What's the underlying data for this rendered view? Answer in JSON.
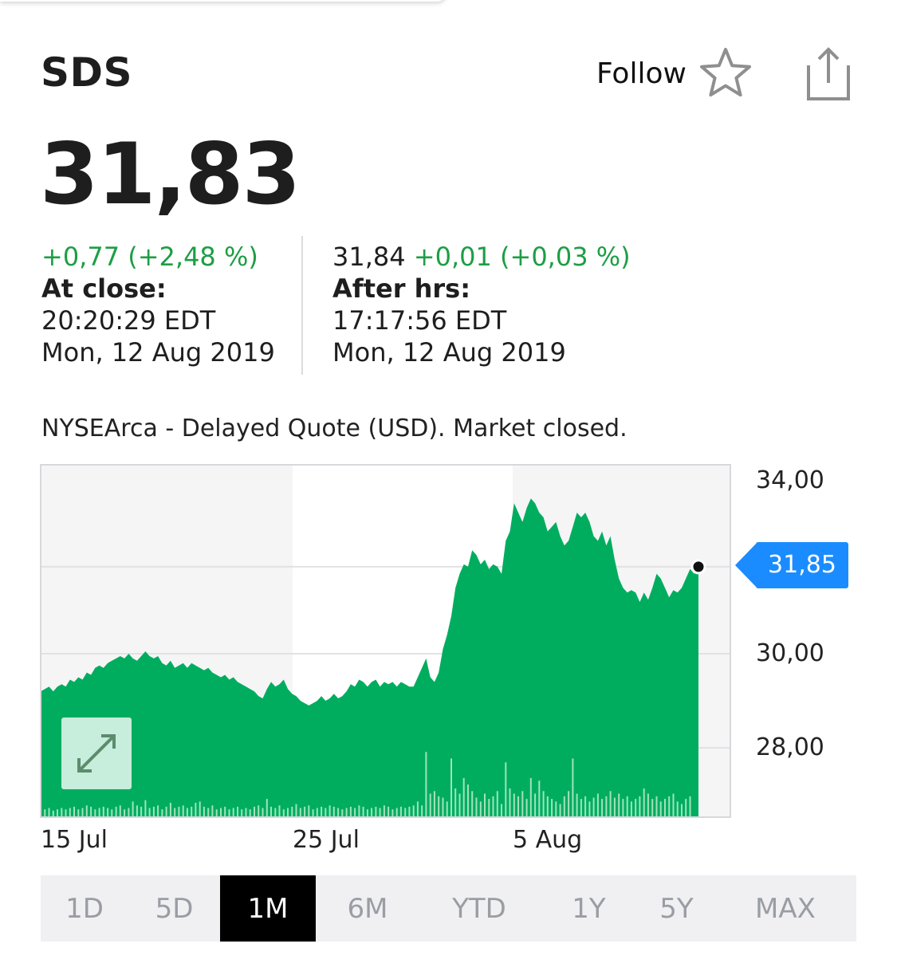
{
  "header": {
    "ticker": "SDS",
    "follow_label": "Follow"
  },
  "quote": {
    "price": "31,83",
    "close_change": "+0,77 (+2,48 %)",
    "close_label": "At close:",
    "close_time": "20:20:29 EDT",
    "close_date": "Mon, 12 Aug 2019",
    "after_price": "31,84",
    "after_change": "+0,01 (+0,03 %)",
    "after_label": "After hrs:",
    "after_time": "17:17:56 EDT",
    "after_date": "Mon, 12 Aug 2019"
  },
  "exchange_note": "NYSEArca - Delayed Quote (USD). Market closed.",
  "colors": {
    "up": "#1d9e45",
    "area": "#00ad5f",
    "tag": "#1a8cff"
  },
  "icons": {
    "follow": "star-icon",
    "share": "share-icon",
    "fullscreen": "expand-icon"
  },
  "chart_data": {
    "type": "area",
    "y_ticks": [
      "34,00",
      "30,00",
      "28,00"
    ],
    "ylim": [
      26.0,
      35.0
    ],
    "x_ticks": [
      "15 Jul",
      "25 Jul",
      "5 Aug"
    ],
    "current_value_label": "31,85",
    "current_value": 31.85,
    "grid": true,
    "series": [
      {
        "values": [
          29.2,
          29.25,
          29.3,
          29.2,
          29.3,
          29.35,
          29.3,
          29.45,
          29.4,
          29.5,
          29.45,
          29.6,
          29.55,
          29.7,
          29.75,
          29.7,
          29.8,
          29.85,
          29.9,
          29.95,
          29.9,
          30.0,
          29.9,
          29.85,
          29.95,
          30.05,
          29.95,
          29.9,
          29.95,
          29.8,
          29.75,
          29.85,
          29.7,
          29.75,
          29.8,
          29.7,
          29.8,
          29.75,
          29.7,
          29.65,
          29.7,
          29.6,
          29.55,
          29.5,
          29.55,
          29.45,
          29.5,
          29.4,
          29.35,
          29.3,
          29.25,
          29.2,
          29.1,
          29.05,
          29.25,
          29.4,
          29.3,
          29.35,
          29.45,
          29.25,
          29.15,
          29.1,
          29.0,
          28.95,
          28.9,
          28.95,
          29.0,
          29.1,
          29.0,
          29.05,
          29.15,
          29.05,
          29.1,
          29.2,
          29.35,
          29.3,
          29.45,
          29.4,
          29.3,
          29.4,
          29.45,
          29.3,
          29.4,
          29.35,
          29.4,
          29.3,
          29.4,
          29.35,
          29.3,
          29.3,
          29.5,
          29.7,
          29.9,
          29.5,
          29.4,
          29.6,
          30.1,
          30.4,
          30.8,
          31.4,
          31.7,
          31.9,
          31.85,
          32.2,
          32.1,
          31.9,
          32.0,
          31.8,
          31.9,
          31.85,
          31.7,
          32.4,
          32.6,
          33.2,
          33.0,
          32.8,
          33.1,
          33.3,
          33.2,
          33.0,
          32.9,
          32.6,
          32.7,
          32.8,
          32.5,
          32.3,
          32.4,
          32.7,
          33.0,
          32.9,
          33.0,
          32.8,
          32.5,
          32.4,
          32.6,
          32.3,
          32.5,
          32.0,
          31.6,
          31.4,
          31.3,
          31.35,
          31.3,
          31.1,
          31.3,
          31.15,
          31.4,
          31.7,
          31.6,
          31.4,
          31.2,
          31.35,
          31.3,
          31.4,
          31.6,
          31.8,
          31.7,
          31.85
        ],
        "volume": [
          0.06,
          0.06,
          0.07,
          0.05,
          0.06,
          0.07,
          0.06,
          0.07,
          0.08,
          0.06,
          0.07,
          0.09,
          0.08,
          0.06,
          0.07,
          0.08,
          0.07,
          0.06,
          0.08,
          0.09,
          0.06,
          0.07,
          0.12,
          0.09,
          0.08,
          0.13,
          0.07,
          0.08,
          0.09,
          0.06,
          0.08,
          0.11,
          0.07,
          0.08,
          0.09,
          0.07,
          0.08,
          0.11,
          0.12,
          0.08,
          0.07,
          0.09,
          0.06,
          0.07,
          0.08,
          0.06,
          0.07,
          0.08,
          0.06,
          0.07,
          0.06,
          0.08,
          0.09,
          0.07,
          0.14,
          0.08,
          0.07,
          0.09,
          0.06,
          0.07,
          0.08,
          0.1,
          0.07,
          0.08,
          0.09,
          0.06,
          0.07,
          0.08,
          0.07,
          0.09,
          0.08,
          0.07,
          0.06,
          0.07,
          0.08,
          0.07,
          0.09,
          0.08,
          0.06,
          0.07,
          0.08,
          0.07,
          0.09,
          0.08,
          0.06,
          0.07,
          0.08,
          0.07,
          0.08,
          0.09,
          0.12,
          0.09,
          0.5,
          0.18,
          0.2,
          0.16,
          0.15,
          0.12,
          0.45,
          0.22,
          0.18,
          0.3,
          0.25,
          0.2,
          0.15,
          0.12,
          0.18,
          0.14,
          0.16,
          0.2,
          0.1,
          0.42,
          0.22,
          0.18,
          0.16,
          0.2,
          0.14,
          0.3,
          0.18,
          0.28,
          0.2,
          0.16,
          0.14,
          0.12,
          0.1,
          0.16,
          0.2,
          0.45,
          0.18,
          0.14,
          0.16,
          0.12,
          0.15,
          0.18,
          0.14,
          0.16,
          0.2,
          0.15,
          0.18,
          0.14,
          0.16,
          0.12,
          0.14,
          0.16,
          0.22,
          0.18,
          0.14,
          0.16,
          0.12,
          0.14,
          0.16,
          0.18,
          0.12,
          0.1,
          0.14,
          0.16
        ]
      }
    ]
  },
  "ranges": {
    "items": [
      {
        "label": "1D",
        "active": false
      },
      {
        "label": "5D",
        "active": false
      },
      {
        "label": "1M",
        "active": true
      },
      {
        "label": "6M",
        "active": false
      },
      {
        "label": "YTD",
        "active": false
      },
      {
        "label": "1Y",
        "active": false
      },
      {
        "label": "5Y",
        "active": false
      },
      {
        "label": "MAX",
        "active": false
      }
    ]
  }
}
